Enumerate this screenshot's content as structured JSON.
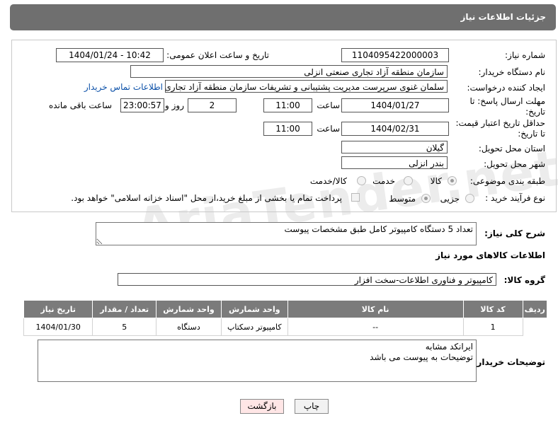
{
  "header": {
    "title": "جزئیات اطلاعات نیاز"
  },
  "form": {
    "need_number_label": "شماره نیاز:",
    "need_number": "1104095422000003",
    "announce_label": "تاریخ و ساعت اعلان عمومی:",
    "announce_value": "1404/01/24 - 10:42",
    "buyer_org_label": "نام دستگاه خریدار:",
    "buyer_org": "سازمان منطقه آزاد تجاری  صنعتی انزلی",
    "requester_label": "ایجاد کننده درخواست:",
    "requester": "سلمان غنوی سرپرست مدیریت پشتیبانی و تشریفات سازمان منطقه آزاد تجاری",
    "contact_link": "اطلاعات تماس خریدار",
    "deadline_label": "مهلت ارسال پاسخ: تا تاریخ:",
    "deadline_date": "1404/01/27",
    "time_label": "ساعت",
    "deadline_time": "11:00",
    "days_value": "2",
    "days_label": "روز و",
    "remaining_time": "23:00:57",
    "remaining_label": "ساعت باقی مانده",
    "price_validity_label": "حداقل تاریخ اعتبار قیمت: تا تاریخ:",
    "price_validity_date": "1404/02/31",
    "price_validity_time": "11:00",
    "province_label": "استان محل تحویل:",
    "province": "گیلان",
    "city_label": "شهر محل تحویل:",
    "city": "بندر انزلی",
    "category_label": "طبقه بندی موضوعی:",
    "category_options": [
      "کالا",
      "خدمت",
      "کالا/خدمت"
    ],
    "process_label": "نوع فرآیند خرید :",
    "process_options": [
      "جزیی",
      "متوسط"
    ],
    "payment_note": "پرداخت تمام یا بخشی از مبلغ خرید،از محل \"اسناد خزانه اسلامی\" خواهد بود."
  },
  "description": {
    "label": "شرح کلی نیاز:",
    "value": "تعداد 5 دستگاه کامپیوتر کامل طبق مشخصات پیوست"
  },
  "goods_section": {
    "title": "اطلاعات کالاهای مورد نیاز"
  },
  "goods_group": {
    "label": "گروه کالا:",
    "value": "کامپیوتر و فناوری اطلاعات-سخت افزار"
  },
  "table": {
    "headers": [
      "ردیف",
      "کد کالا",
      "نام کالا",
      "واحد شمارش",
      "تعداد / مقدار",
      "تاریخ نیاز"
    ],
    "rows": [
      [
        "1",
        "--",
        "کامپیوتر دسکتاپ",
        "دستگاه",
        "5",
        "1404/01/30"
      ]
    ]
  },
  "buyer_notes": {
    "label": "توضیحات خریدار:",
    "line1": "ایرانکد مشابه",
    "line2": "توضیحات به پیوست می باشد"
  },
  "buttons": {
    "print": "چاپ",
    "back": "بازگشت"
  },
  "watermark": "AriaTender.net"
}
